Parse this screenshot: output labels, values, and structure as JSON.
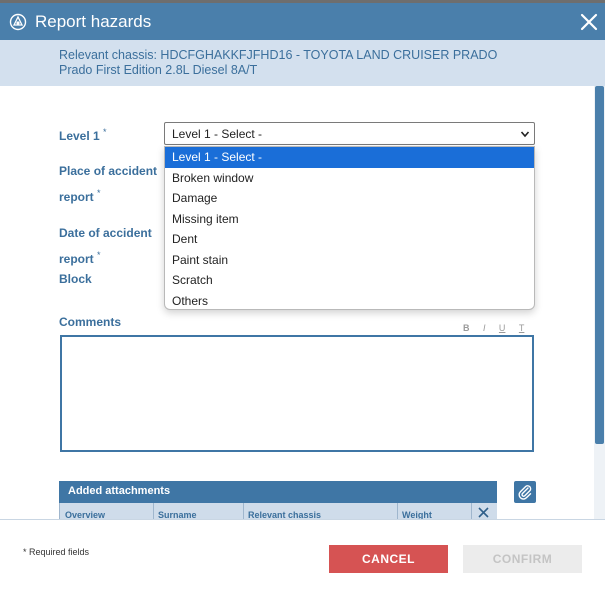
{
  "dialog": {
    "title": "Report hazards",
    "chassis_text": "Relevant chassis: HDCFGHAKKFJFHD16 - TOYOTA LAND CRUISER PRADO Prado First Edition 2.8L Diesel 8A/T"
  },
  "form": {
    "level1": {
      "label": "Level 1",
      "required_mark": "*",
      "selected": "Level 1 - Select -",
      "options": [
        "Level 1 - Select -",
        "Broken window",
        "Damage",
        "Missing item",
        "Dent",
        "Paint stain",
        "Scratch",
        "Others"
      ]
    },
    "place": {
      "label_line1": "Place of accident",
      "label_line2": "report",
      "required_mark": "*"
    },
    "date": {
      "label_line1": "Date of accident",
      "label_line2": "report",
      "required_mark": "*"
    },
    "block": {
      "label": "Block"
    },
    "comments": {
      "label": "Comments",
      "tools": {
        "bold": "B",
        "italic": "I",
        "underline": "U",
        "clear": "T"
      }
    }
  },
  "attachments": {
    "title": "Added attachments",
    "columns": [
      "Overview",
      "Surname",
      "Relevant chassis",
      "Weight"
    ]
  },
  "footer": {
    "required_text": "* Required fields",
    "cancel_label": "CANCEL",
    "confirm_label": "CONFIRM"
  },
  "colors": {
    "header": "#4a7fab",
    "band": "#d3e0ee",
    "label": "#3b6f9c",
    "selected_option": "#1a6ed8",
    "cancel": "#d65353",
    "confirm_disabled": "#ececec"
  },
  "icons": {
    "logo": "engine-logo-icon",
    "close": "close-icon",
    "chevron": "chevron-down-icon",
    "attach": "paperclip-icon",
    "remove": "close-icon"
  }
}
